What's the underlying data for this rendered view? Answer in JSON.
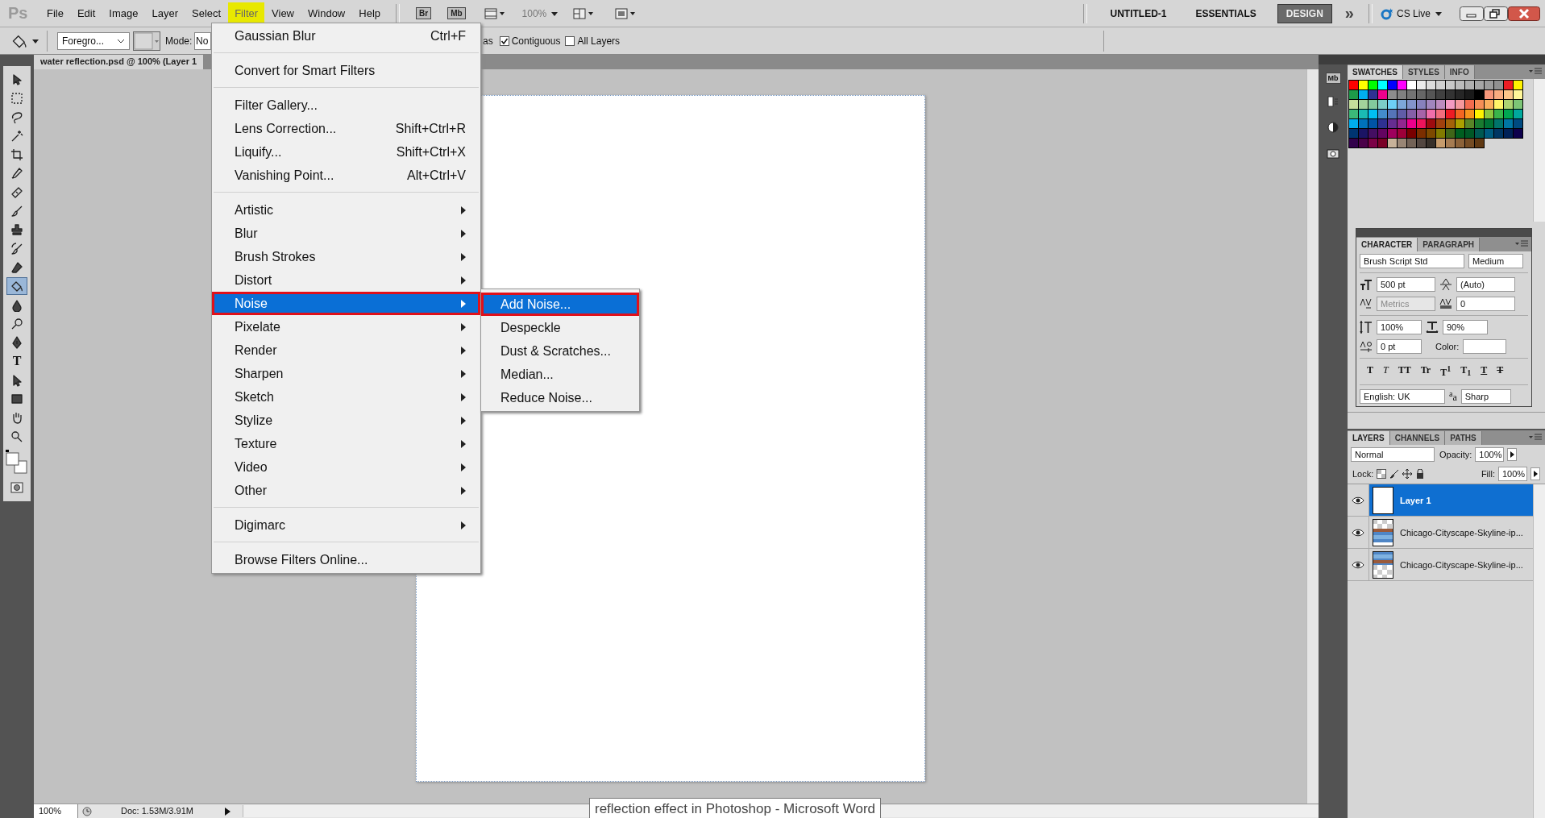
{
  "menubar": {
    "logo": "Ps",
    "menus": [
      {
        "label": "File",
        "selected": false
      },
      {
        "label": "Edit",
        "selected": false
      },
      {
        "label": "Image",
        "selected": false
      },
      {
        "label": "Layer",
        "selected": false
      },
      {
        "label": "Select",
        "selected": false
      },
      {
        "label": "Filter",
        "selected": true
      },
      {
        "label": "View",
        "selected": false
      },
      {
        "label": "Window",
        "selected": false
      },
      {
        "label": "Help",
        "selected": false
      }
    ],
    "app_buttons": [
      "Br",
      "Mb"
    ],
    "zoom": "100%"
  },
  "workspace": {
    "document": "UNTITLED-1",
    "workspaces": [
      {
        "label": "ESSENTIALS",
        "selected": false
      },
      {
        "label": "DESIGN",
        "selected": true
      }
    ],
    "more": "»",
    "cs_live": "CS Live"
  },
  "options_bar": {
    "fill_source": "Foregro...",
    "mode_label": "Mode:",
    "mode_value": "No",
    "antialias_tail": "as",
    "contiguous": {
      "label": "Contiguous",
      "checked": true
    },
    "all_layers": {
      "label": "All Layers",
      "checked": false
    }
  },
  "document_tab": {
    "title": "water reflection.psd @ 100% (Layer 1"
  },
  "tools": [
    {
      "kind": "move",
      "selected": false
    },
    {
      "kind": "marquee",
      "selected": false
    },
    {
      "kind": "lasso",
      "selected": false
    },
    {
      "kind": "wand",
      "selected": false
    },
    {
      "kind": "crop",
      "selected": false
    },
    {
      "kind": "eyedropper",
      "selected": false
    },
    {
      "kind": "bandage",
      "selected": false
    },
    {
      "kind": "brush",
      "selected": false
    },
    {
      "kind": "stamp",
      "selected": false
    },
    {
      "kind": "history",
      "selected": false
    },
    {
      "kind": "eraser",
      "selected": false
    },
    {
      "kind": "bucket",
      "selected": true
    },
    {
      "kind": "drop",
      "selected": false
    },
    {
      "kind": "dodge",
      "selected": false
    },
    {
      "kind": "pen",
      "selected": false
    },
    {
      "kind": "type",
      "glyph": "T",
      "selected": false
    },
    {
      "kind": "select",
      "selected": false
    },
    {
      "kind": "rect",
      "selected": false
    },
    {
      "kind": "hand",
      "selected": false
    },
    {
      "kind": "zoom",
      "selected": false
    }
  ],
  "filter_menu": {
    "groups": [
      [
        {
          "label": "Gaussian Blur",
          "shortcut": "Ctrl+F",
          "submenu": false,
          "selected": false
        }
      ],
      [
        {
          "label": "Convert for Smart Filters",
          "submenu": false,
          "selected": false
        }
      ],
      [
        {
          "label": "Filter Gallery...",
          "submenu": false,
          "selected": false
        },
        {
          "label": "Lens Correction...",
          "shortcut": "Shift+Ctrl+R",
          "submenu": false,
          "selected": false
        },
        {
          "label": "Liquify...",
          "shortcut": "Shift+Ctrl+X",
          "submenu": false,
          "selected": false
        },
        {
          "label": "Vanishing Point...",
          "shortcut": "Alt+Ctrl+V",
          "submenu": false,
          "selected": false
        }
      ],
      [
        {
          "label": "Artistic",
          "submenu": true,
          "selected": false
        },
        {
          "label": "Blur",
          "submenu": true,
          "selected": false
        },
        {
          "label": "Brush Strokes",
          "submenu": true,
          "selected": false
        },
        {
          "label": "Distort",
          "submenu": true,
          "selected": false
        },
        {
          "label": "Noise",
          "submenu": true,
          "selected": true
        },
        {
          "label": "Pixelate",
          "submenu": true,
          "selected": false
        },
        {
          "label": "Render",
          "submenu": true,
          "selected": false
        },
        {
          "label": "Sharpen",
          "submenu": true,
          "selected": false
        },
        {
          "label": "Sketch",
          "submenu": true,
          "selected": false
        },
        {
          "label": "Stylize",
          "submenu": true,
          "selected": false
        },
        {
          "label": "Texture",
          "submenu": true,
          "selected": false
        },
        {
          "label": "Video",
          "submenu": true,
          "selected": false
        },
        {
          "label": "Other",
          "submenu": true,
          "selected": false
        }
      ],
      [
        {
          "label": "Digimarc",
          "submenu": true,
          "selected": false
        }
      ],
      [
        {
          "label": "Browse Filters Online...",
          "submenu": false,
          "selected": false
        }
      ]
    ]
  },
  "noise_submenu": {
    "items": [
      {
        "label": "Add Noise...",
        "selected": true
      },
      {
        "label": "Despeckle",
        "selected": false
      },
      {
        "label": "Dust & Scratches...",
        "selected": false
      },
      {
        "label": "Median...",
        "selected": false
      },
      {
        "label": "Reduce Noise...",
        "selected": false
      }
    ]
  },
  "dock_icons": {
    "label": "Mb"
  },
  "swatches_panel": {
    "tabs": [
      {
        "label": "SWATCHES",
        "selected": true
      },
      {
        "label": "STYLES",
        "selected": false
      },
      {
        "label": "INFO",
        "selected": false
      }
    ],
    "swatches": [
      {
        "color": "#ff0000"
      },
      {
        "color": "#ffff00"
      },
      {
        "color": "#00ff00"
      },
      {
        "color": "#00ffff"
      },
      {
        "color": "#0000ff"
      },
      {
        "color": "#ff00ff"
      },
      {
        "color": "#ffffff"
      },
      {
        "color": "#ebebeb"
      },
      {
        "color": "#dcdcdc"
      },
      {
        "color": "#d0d0d0"
      },
      {
        "color": "#c8c8c8"
      },
      {
        "color": "#bcbcbc"
      },
      {
        "color": "#b0b0b0"
      },
      {
        "color": "#a6a6a6"
      },
      {
        "color": "#9c9c9c"
      },
      {
        "color": "#919191"
      },
      {
        "color": "#ed1c24"
      },
      {
        "color": "#fff200"
      },
      {
        "color": "#1d9a4a"
      },
      {
        "color": "#00aeef"
      },
      {
        "color": "#2e3192"
      },
      {
        "color": "#ec008c"
      },
      {
        "color": "#8c8c8c"
      },
      {
        "color": "#808080"
      },
      {
        "color": "#737373"
      },
      {
        "color": "#666666"
      },
      {
        "color": "#555555"
      },
      {
        "color": "#404040"
      },
      {
        "color": "#333333"
      },
      {
        "color": "#262626"
      },
      {
        "color": "#1a1a1a"
      },
      {
        "color": "#000000"
      },
      {
        "color": "#f7977a"
      },
      {
        "color": "#f9ad81"
      },
      {
        "color": "#fdc68a"
      },
      {
        "color": "#fff799"
      },
      {
        "color": "#c4df9b"
      },
      {
        "color": "#a3d39c"
      },
      {
        "color": "#82ca9d"
      },
      {
        "color": "#7bcdc8"
      },
      {
        "color": "#6dcff6"
      },
      {
        "color": "#7da7d9"
      },
      {
        "color": "#8393ca"
      },
      {
        "color": "#8781bd"
      },
      {
        "color": "#a186be"
      },
      {
        "color": "#bd8cbf"
      },
      {
        "color": "#f49ac2"
      },
      {
        "color": "#f5989d"
      },
      {
        "color": "#f26c4f"
      },
      {
        "color": "#f68e56"
      },
      {
        "color": "#fbaf5d"
      },
      {
        "color": "#fff568"
      },
      {
        "color": "#acd372"
      },
      {
        "color": "#7cc576"
      },
      {
        "color": "#3bb878"
      },
      {
        "color": "#1abbb4"
      },
      {
        "color": "#00bff3"
      },
      {
        "color": "#438ccb"
      },
      {
        "color": "#5574b9"
      },
      {
        "color": "#605ca8"
      },
      {
        "color": "#855fa8"
      },
      {
        "color": "#a763a8"
      },
      {
        "color": "#f06eaa"
      },
      {
        "color": "#f26d7d"
      },
      {
        "color": "#ed1c24"
      },
      {
        "color": "#f26522"
      },
      {
        "color": "#f7941d"
      },
      {
        "color": "#fff200"
      },
      {
        "color": "#8dc73f"
      },
      {
        "color": "#39b54a"
      },
      {
        "color": "#00a651"
      },
      {
        "color": "#00a99d"
      },
      {
        "color": "#00aeef"
      },
      {
        "color": "#0072bc"
      },
      {
        "color": "#0054a6"
      },
      {
        "color": "#2e3192"
      },
      {
        "color": "#662d91"
      },
      {
        "color": "#92278f"
      },
      {
        "color": "#ec008c"
      },
      {
        "color": "#ed145b"
      },
      {
        "color": "#9e0b0f"
      },
      {
        "color": "#a0410d"
      },
      {
        "color": "#a36209"
      },
      {
        "color": "#aba000"
      },
      {
        "color": "#598527"
      },
      {
        "color": "#197b30"
      },
      {
        "color": "#007236"
      },
      {
        "color": "#00746b"
      },
      {
        "color": "#0076a3"
      },
      {
        "color": "#004a80"
      },
      {
        "color": "#003471"
      },
      {
        "color": "#1b1464"
      },
      {
        "color": "#440e62"
      },
      {
        "color": "#630460"
      },
      {
        "color": "#9e005d"
      },
      {
        "color": "#9e0039"
      },
      {
        "color": "#790000"
      },
      {
        "color": "#7b2e00"
      },
      {
        "color": "#7d4900"
      },
      {
        "color": "#827b00"
      },
      {
        "color": "#406618"
      },
      {
        "color": "#005e20"
      },
      {
        "color": "#005826"
      },
      {
        "color": "#005952"
      },
      {
        "color": "#005b7f"
      },
      {
        "color": "#003663"
      },
      {
        "color": "#002157"
      },
      {
        "color": "#0d004c"
      },
      {
        "color": "#32004b"
      },
      {
        "color": "#4b0049"
      },
      {
        "color": "#7b0046"
      },
      {
        "color": "#7a0026"
      },
      {
        "color": "#c7b299"
      },
      {
        "color": "#998675"
      },
      {
        "color": "#736357"
      },
      {
        "color": "#534741"
      },
      {
        "color": "#37302a"
      },
      {
        "color": "#c69c6d"
      },
      {
        "color": "#a67c52"
      },
      {
        "color": "#8c6239"
      },
      {
        "color": "#754c24"
      },
      {
        "color": "#603913"
      }
    ]
  },
  "character_panel": {
    "tabs": [
      {
        "label": "CHARACTER",
        "selected": true
      },
      {
        "label": "PARAGRAPH",
        "selected": false
      }
    ],
    "font_family": "Brush Script Std",
    "font_style": "Medium",
    "size": "500 pt",
    "leading": "(Auto)",
    "kerning": {
      "value": "Metrics",
      "disabled": true
    },
    "tracking": "0",
    "vertical_scale": "100%",
    "horizontal_scale": "90%",
    "baseline_shift": "0 pt",
    "color_label": "Color:",
    "style_buttons": [
      {
        "glyph": "T",
        "kind": "bold"
      },
      {
        "glyph": "T",
        "kind": "italic"
      },
      {
        "glyph": "TT",
        "kind": "plain"
      },
      {
        "glyph": "Tr",
        "kind": "plain"
      },
      {
        "glyph": "T$^{1}$",
        "kind": "plain"
      },
      {
        "glyph": "T$_{1}$",
        "kind": "plain"
      },
      {
        "glyph": "T",
        "kind": "underline"
      },
      {
        "glyph": "T",
        "kind": "strike"
      }
    ],
    "language": "English: UK",
    "antialias_icon": "$^{a}$a",
    "antialias": "Sharp"
  },
  "layers_panel": {
    "tabs": [
      {
        "label": "LAYERS",
        "selected": true
      },
      {
        "label": "CHANNELS",
        "selected": false
      },
      {
        "label": "PATHS",
        "selected": false
      }
    ],
    "blend_mode": "Normal",
    "opacity_label": "Opacity:",
    "opacity": "100%",
    "lock_label": "Lock:",
    "fill_label": "Fill:",
    "fill": "100%",
    "layers": [
      {
        "name": "Layer 1",
        "selected": true,
        "visible": true,
        "kind": "blank"
      },
      {
        "name": "Chicago-Cityscape-Skyline-ip...",
        "selected": false,
        "visible": true,
        "kind": "reflection"
      },
      {
        "name": "Chicago-Cityscape-Skyline-ip...",
        "selected": false,
        "visible": true
      }
    ]
  },
  "status_bar": {
    "zoom": "100%",
    "doc_info": "Doc: 1.53M/3.91M"
  },
  "taskbar_tooltip": "reflection effect in Photoshop - Microsoft Word"
}
